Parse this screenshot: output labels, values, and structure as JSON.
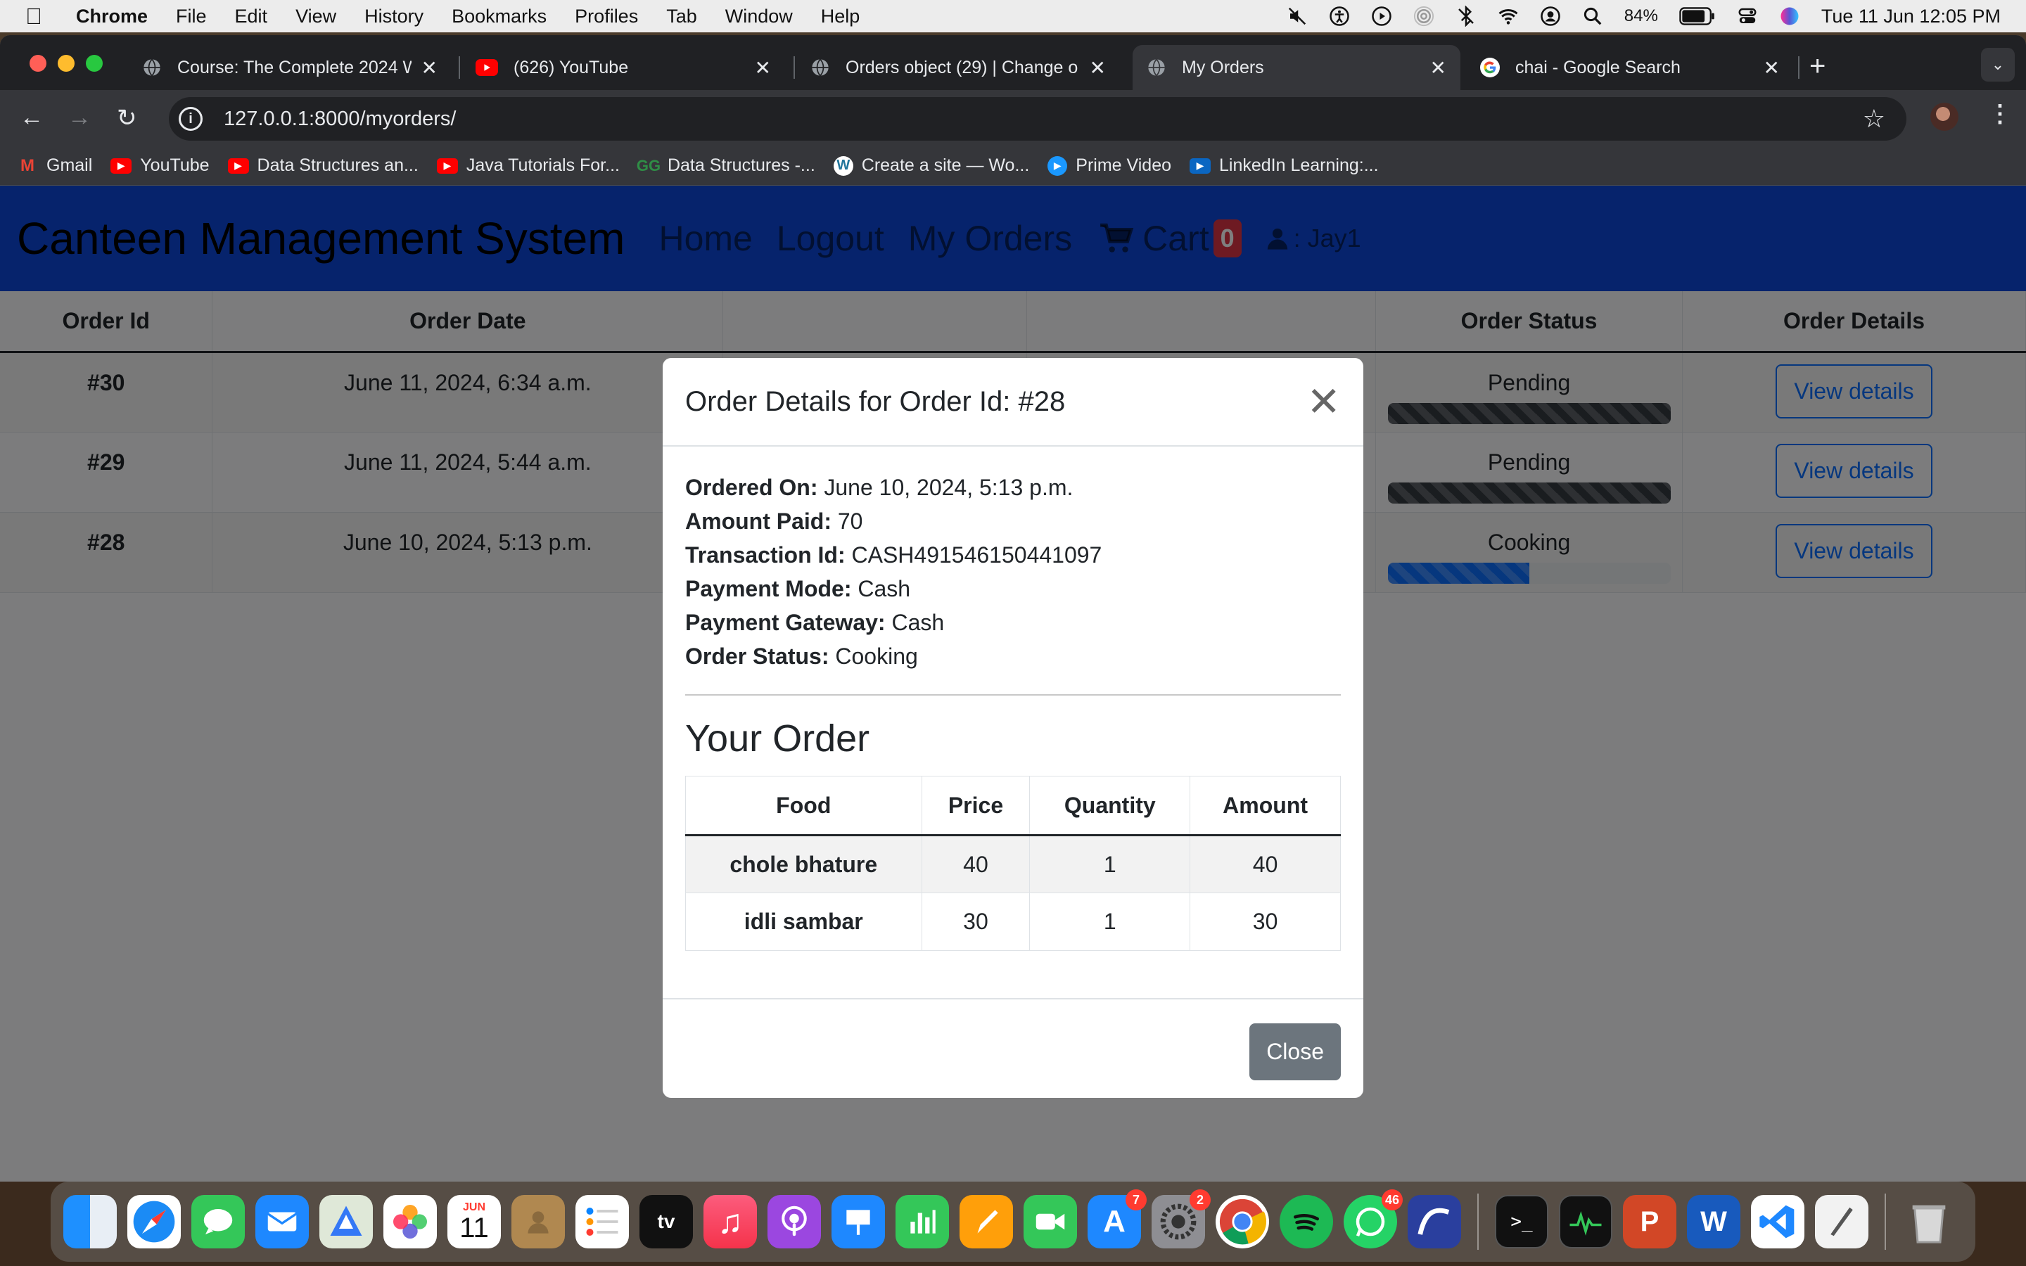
{
  "menubar": {
    "app_name": "Chrome",
    "items": [
      "File",
      "Edit",
      "View",
      "History",
      "Bookmarks",
      "Profiles",
      "Tab",
      "Window",
      "Help"
    ],
    "battery": "84%",
    "datetime": "Tue 11 Jun  12:05 PM"
  },
  "tabs": [
    {
      "title": "Course: The Complete 2024 W",
      "favicon": "globe-icon"
    },
    {
      "title": "(626) YouTube",
      "favicon": "youtube-icon"
    },
    {
      "title": "Orders object (29) | Change o",
      "favicon": "globe-icon"
    },
    {
      "title": "My Orders",
      "favicon": "globe-icon"
    },
    {
      "title": "chai - Google Search",
      "favicon": "google-icon"
    }
  ],
  "address_bar": {
    "url": "127.0.0.1:8000/myorders/"
  },
  "bookmarks": [
    {
      "label": "Gmail",
      "color": "#ea4335"
    },
    {
      "label": "YouTube",
      "color": "#ff0000"
    },
    {
      "label": "Data Structures an...",
      "color": "#ff0000"
    },
    {
      "label": "Java Tutorials For...",
      "color": "#ff0000"
    },
    {
      "label": "Data Structures -...",
      "color": "#2f8d46"
    },
    {
      "label": "Create a site — Wo...",
      "color": "#ffffff"
    },
    {
      "label": "Prime Video",
      "color": "#1a98ff"
    },
    {
      "label": "LinkedIn Learning:...",
      "color": "#0a66c2"
    }
  ],
  "site": {
    "brand": "Canteen Management System",
    "nav": {
      "home": "Home",
      "logout": "Logout",
      "my_orders": "My Orders",
      "cart": "Cart",
      "cart_count": "0",
      "user": ": Jay1"
    },
    "accent": "#0d47d9"
  },
  "orders_table": {
    "headers": {
      "order_id": "Order Id",
      "order_date": "Order Date",
      "order_status": "Order Status",
      "order_details": "Order Details"
    },
    "rows": [
      {
        "id": "#30",
        "date": "June 11, 2024, 6:34 a.m.",
        "status": "Pending",
        "progress_pct": 100,
        "bar_color": "#343a40",
        "action": "View details"
      },
      {
        "id": "#29",
        "date": "June 11, 2024, 5:44 a.m.",
        "status": "Pending",
        "progress_pct": 100,
        "bar_color": "#343a40",
        "action": "View details"
      },
      {
        "id": "#28",
        "date": "June 10, 2024, 5:13 p.m.",
        "status": "Cooking",
        "progress_pct": 50,
        "bar_color": "#0d6efd",
        "action": "View details"
      }
    ]
  },
  "modal": {
    "title": "Order Details for Order Id: #28",
    "details": [
      {
        "label": "Ordered On:",
        "value": "June 10, 2024, 5:13 p.m."
      },
      {
        "label": "Amount Paid:",
        "value": "70"
      },
      {
        "label": "Transaction Id:",
        "value": "CASH491546150441097"
      },
      {
        "label": "Payment Mode:",
        "value": "Cash"
      },
      {
        "label": "Payment Gateway:",
        "value": "Cash"
      },
      {
        "label": "Order Status:",
        "value": "Cooking"
      }
    ],
    "section_title": "Your Order",
    "items_headers": {
      "food": "Food",
      "price": "Price",
      "quantity": "Quantity",
      "amount": "Amount"
    },
    "items": [
      {
        "food": "chole bhature",
        "price": "40",
        "quantity": "1",
        "amount": "40"
      },
      {
        "food": "idli sambar",
        "price": "30",
        "quantity": "1",
        "amount": "30"
      }
    ],
    "close_label": "Close"
  },
  "dock": {
    "badges": {
      "appstore": "7",
      "settings": "2",
      "whatsapp": "46"
    },
    "calendar_month": "JUN",
    "calendar_day": "11",
    "appletv_label": "tv"
  }
}
